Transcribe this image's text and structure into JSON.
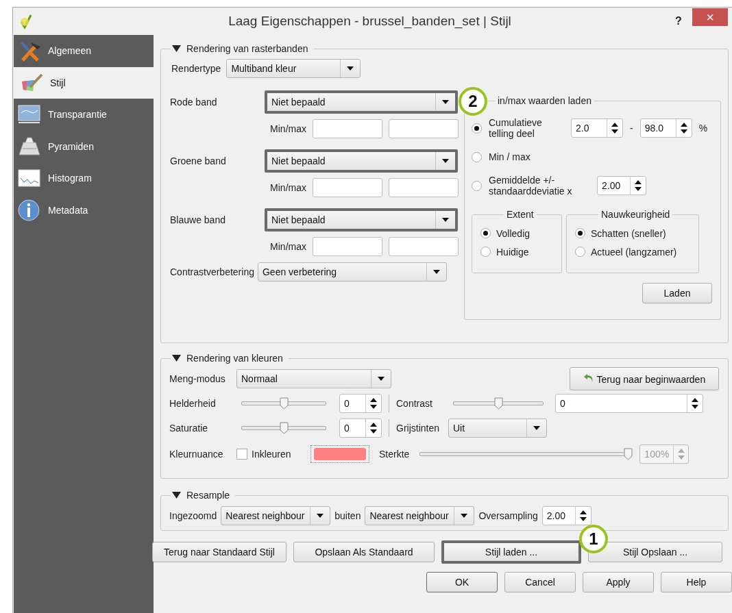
{
  "window": {
    "title": "Laag Eigenschappen - brussel_banden_set | Stijl",
    "help": "?",
    "close": "×"
  },
  "sidebar": {
    "items": [
      {
        "label": "Algemeen",
        "selected": false
      },
      {
        "label": "Stijl",
        "selected": true
      },
      {
        "label": "Transparantie",
        "selected": false
      },
      {
        "label": "Pyramiden",
        "selected": false
      },
      {
        "label": "Histogram",
        "selected": false
      },
      {
        "label": "Metadata",
        "selected": false
      }
    ]
  },
  "raster_bands": {
    "title": "Rendering van rasterbanden",
    "expanded": true,
    "render_type": {
      "label": "Rendertype",
      "value": "Multiband kleur"
    },
    "bands": [
      {
        "label": "Rode band",
        "value": "Niet bepaald",
        "highlighted": true,
        "minmax_label": "Min/max"
      },
      {
        "label": "Groene band",
        "value": "Niet bepaald",
        "highlighted": true,
        "minmax_label": "Min/max"
      },
      {
        "label": "Blauwe band",
        "value": "Niet bepaald",
        "highlighted": true,
        "minmax_label": "Min/max"
      }
    ],
    "contrast": {
      "label": "Contrastverbetering",
      "value": "Geen verbetering"
    },
    "minmax_load": {
      "title": "in/max waarden laden",
      "options": [
        {
          "kind": "range",
          "label": "Cumulatieve telling deel",
          "selected": true,
          "from": "2.0",
          "separator": "-",
          "to": "98.0",
          "unit": "%"
        },
        {
          "kind": "plain",
          "label": "Min / max",
          "selected": false
        },
        {
          "kind": "factor",
          "label": "Gemiddelde +/- standaarddeviatie x",
          "selected": false,
          "value": "2.00"
        }
      ],
      "extent": {
        "title": "Extent",
        "options": [
          {
            "label": "Volledig",
            "selected": true
          },
          {
            "label": "Huidige",
            "selected": false
          }
        ]
      },
      "accuracy": {
        "title": "Nauwkeurigheid",
        "options": [
          {
            "label": "Schatten (sneller)",
            "selected": true
          },
          {
            "label": "Actueel (langzamer)",
            "selected": false
          }
        ]
      },
      "load_button": "Laden"
    }
  },
  "color_rendering": {
    "title": "Rendering van kleuren",
    "expanded": true,
    "blend": {
      "label": "Meng-modus",
      "value": "Normaal"
    },
    "reset_button": "Terug naar beginwaarden",
    "brightness": {
      "label": "Helderheid",
      "level": 0.5,
      "value": "0"
    },
    "contrast": {
      "label": "Contrast",
      "level": 0.5,
      "value": "0"
    },
    "saturation": {
      "label": "Saturatie",
      "level": 0.5,
      "value": "0"
    },
    "grayscale": {
      "label": "Grijstinten",
      "value": "Uit"
    },
    "hue": {
      "label": "Kleurnuance",
      "colorize": {
        "label": "Inkleuren",
        "checked": false
      },
      "color": "#ff8080",
      "strength": {
        "label": "Sterkte",
        "level": 1,
        "value": "100%",
        "disabled": true
      }
    }
  },
  "resample": {
    "title": "Resample",
    "expanded": true,
    "zoomed_in": {
      "label": "Ingezoomd",
      "value": "Nearest neighbour"
    },
    "zoomed_out": {
      "label": "buiten",
      "value": "Nearest neighbour"
    },
    "oversampling": {
      "label": "Oversampling",
      "value": "2.00"
    }
  },
  "style_buttons": [
    {
      "label": "Terug naar Standaard Stijl",
      "highlighted": false
    },
    {
      "label": "Opslaan Als Standaard",
      "highlighted": false
    },
    {
      "label": "Stijl laden ...",
      "highlighted": true
    },
    {
      "label": "Stijl Opslaan ...",
      "highlighted": false
    }
  ],
  "dialog_buttons": [
    {
      "label": "OK",
      "default": true
    },
    {
      "label": "Cancel",
      "default": false
    },
    {
      "label": "Apply",
      "default": false
    },
    {
      "label": "Help",
      "default": false
    }
  ],
  "annotations": [
    {
      "number": "2"
    },
    {
      "number": "1"
    }
  ]
}
